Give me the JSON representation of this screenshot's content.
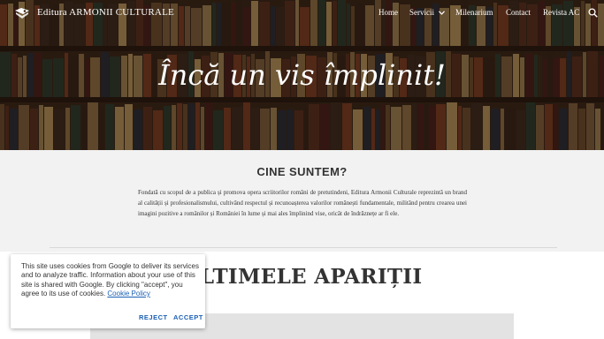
{
  "header": {
    "site_title": "Editura ARMONII CULTURALE",
    "logo_icon": "book-logo-icon",
    "nav": {
      "home": "Home",
      "servicii": "Servicii",
      "milenarium": "Milenarium",
      "contact": "Contact",
      "revista": "Revista AC"
    },
    "search_icon": "search-icon",
    "dropdown_icon": "chevron-down-icon"
  },
  "hero": {
    "title": "Încă un vis împlinit!"
  },
  "about": {
    "heading": "CINE SUNTEM?",
    "text": "Fondată cu scopul de a publica și promova opera scriitorilor români de pretutindeni, Editura Armonii Culturale reprezintă un brand al calității și profesionalismului, cultivând respectul și recunoașterea valorilor românești fundamentale, militând pentru crearea unei imagini pozitive a românilor și României în lume și mai ales împlinind vise, oricât de îndrăznețe ar fi ele."
  },
  "latest": {
    "heading": "ULTIMELE APARIȚII"
  },
  "cookie_banner": {
    "text": "This site uses cookies from Google to deliver its services and to analyze traffic. Information about your use of this site is shared with Google. By clicking \"accept\", you agree to its use of cookies.",
    "link": "Cookie Policy",
    "reject": "REJECT",
    "accept": "ACCEPT"
  },
  "colors": {
    "heading_text": "#333333",
    "about_bg": "#f2f2f2",
    "link_blue": "#1a5fb4"
  }
}
